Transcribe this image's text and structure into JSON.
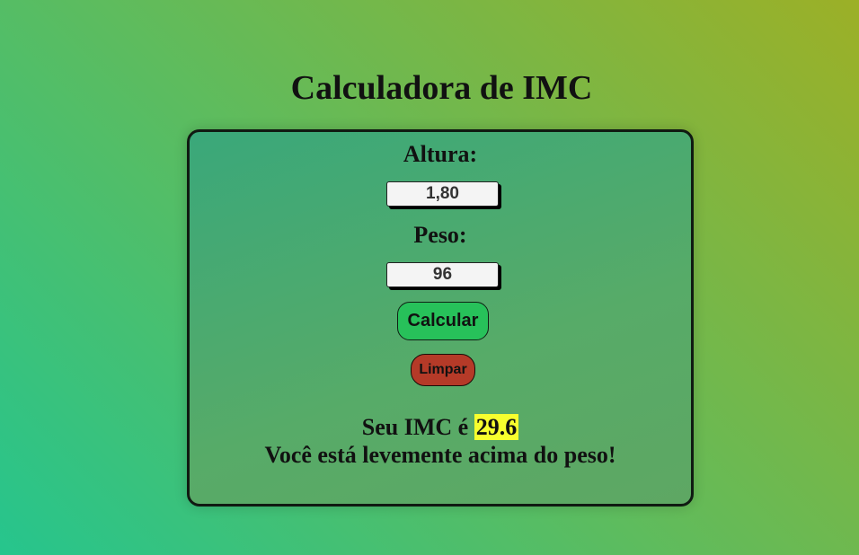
{
  "page": {
    "title": "Calculadora de IMC"
  },
  "form": {
    "altura_label": "Altura:",
    "altura_value": "1,80",
    "peso_label": "Peso:",
    "peso_value": "96",
    "calcular_label": "Calcular",
    "limpar_label": "Limpar"
  },
  "result": {
    "prefix": "Seu IMC é",
    "imc": "29.6",
    "message": "Você está levemente acima do peso!"
  },
  "colors": {
    "background_start": "#26c58d",
    "background_end": "#9cb027",
    "card": "#4fab6e",
    "calcular_button": "#27c15a",
    "limpar_button": "#b53a28",
    "imc_highlight": "#f7ff2e"
  }
}
